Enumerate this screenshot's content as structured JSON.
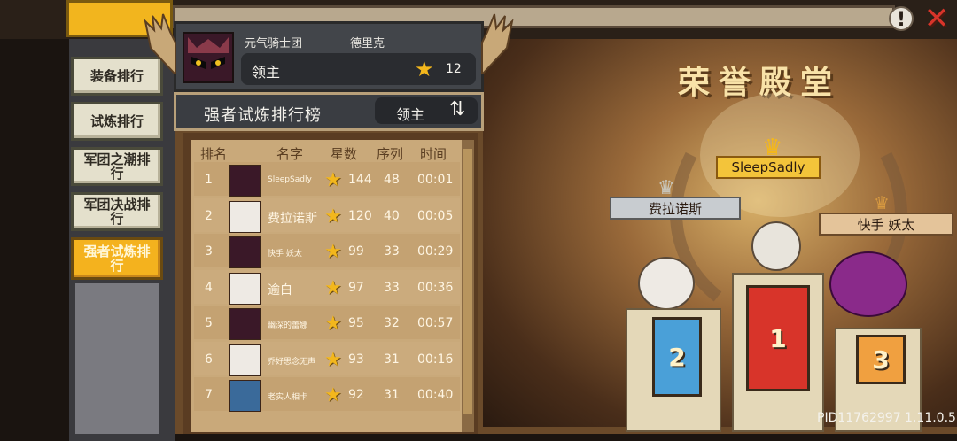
{
  "profile": {
    "guild": "元气骑士团",
    "player": "德里克",
    "rank_label": "领主",
    "stars": "12"
  },
  "leaderboard": {
    "title": "强者试炼排行榜",
    "filter": "领主",
    "columns": [
      "排名",
      "名字",
      "星数",
      "序列",
      "时间"
    ],
    "rows": [
      {
        "rank": "1",
        "name": "SleepSadly",
        "stars": "144",
        "sequence": "48",
        "time": "00:01",
        "avatar": "demon-avatar"
      },
      {
        "rank": "2",
        "name": "费拉诺斯",
        "stars": "120",
        "sequence": "40",
        "time": "00:05",
        "avatar": "white-hair-avatar"
      },
      {
        "rank": "3",
        "name": "快手 妖太",
        "stars": "99",
        "sequence": "33",
        "time": "00:29",
        "avatar": "demon-avatar"
      },
      {
        "rank": "4",
        "name": "逾白",
        "stars": "97",
        "sequence": "33",
        "time": "00:36",
        "avatar": "white-hair-avatar"
      },
      {
        "rank": "5",
        "name": "幽深的蕾娜",
        "stars": "95",
        "sequence": "32",
        "time": "00:57",
        "avatar": "demon-avatar"
      },
      {
        "rank": "6",
        "name": "乔好思念无声",
        "stars": "93",
        "sequence": "31",
        "time": "00:16",
        "avatar": "white-hair-avatar"
      },
      {
        "rank": "7",
        "name": "老实人相卡",
        "stars": "92",
        "sequence": "31",
        "time": "00:40",
        "avatar": "blue-avatar"
      }
    ]
  },
  "sidebar": {
    "items": [
      {
        "label": "装备排行"
      },
      {
        "label": "试炼排行"
      },
      {
        "label": "军团之潮排行"
      },
      {
        "label": "军团决战排行"
      },
      {
        "label": "强者试炼排行"
      }
    ]
  },
  "hall": {
    "title": "荣誉殿堂",
    "first": {
      "name": "SleepSadly",
      "place": "1"
    },
    "second": {
      "name": "费拉诺斯",
      "place": "2"
    },
    "third": {
      "name": "快手 妖太",
      "place": "3"
    }
  },
  "footer": {
    "pid": "PID11762997 1.11.0.5"
  },
  "icons": {
    "warn": "!",
    "close": "✕",
    "star": "★",
    "swap": "⇅"
  },
  "colors": {
    "gold": "#f3b71c",
    "panel": "#42454a",
    "table": "#c9a97a",
    "first_banner": "#d8342a",
    "second_banner": "#4aa0d8",
    "third_banner": "#f0a040"
  }
}
